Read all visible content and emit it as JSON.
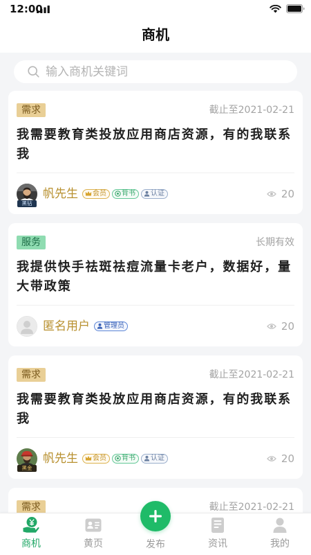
{
  "status_bar": {
    "time": "12:00",
    "icons": [
      "signal-icon",
      "wifi-icon",
      "battery-icon"
    ]
  },
  "header": {
    "title": "商机"
  },
  "search": {
    "placeholder": "输入商机关键词",
    "icon": "search-icon"
  },
  "cards": [
    {
      "tag": "需求",
      "validity": "截止至2021-02-21",
      "title": "我需要教育类投放应用商店资源，有的我联系我",
      "user": {
        "name": "帆先生",
        "level": "黑钻",
        "badges": [
          {
            "label": "会员",
            "icon": "crown-icon"
          },
          {
            "label": "背书",
            "icon": "endorse-icon"
          },
          {
            "label": "认证",
            "icon": "user-icon"
          }
        ]
      },
      "views": 20
    },
    {
      "tag": "服务",
      "validity": "长期有效",
      "title": "我提供快手祛斑祛痘流量卡老户，数据好，量大带政策",
      "user": {
        "name": "匿名用户",
        "badges": [
          {
            "label": "管理员",
            "icon": "user-icon"
          }
        ]
      },
      "views": 20
    },
    {
      "tag": "需求",
      "validity": "截止至2021-02-21",
      "title": "我需要教育类投放应用商店资源，有的我联系我",
      "user": {
        "name": "帆先生",
        "level": "黑金",
        "badges": [
          {
            "label": "会员",
            "icon": "crown-icon"
          },
          {
            "label": "背书",
            "icon": "endorse-icon"
          },
          {
            "label": "认证",
            "icon": "user-icon"
          }
        ]
      },
      "views": 20
    },
    {
      "tag": "需求",
      "validity": "截止至2021-02-21"
    }
  ],
  "nav": {
    "items": [
      {
        "label": "商机",
        "icon": "business-icon",
        "active": true
      },
      {
        "label": "黄页",
        "icon": "contacts-card-icon",
        "active": false
      },
      {
        "label": "发布",
        "icon": "plus-icon",
        "active": false
      },
      {
        "label": "资讯",
        "icon": "news-icon",
        "active": false
      },
      {
        "label": "我的",
        "icon": "profile-icon",
        "active": false
      }
    ]
  },
  "colors": {
    "accent": "#22a867",
    "publish_button": "#1fbb68",
    "username": "#b8902f",
    "demand_tag_bg": "#e9cf96",
    "service_tag_bg": "#8fdcb1",
    "page_bg": "#f4f5f7",
    "inactive_nav": "#9b9b9b"
  }
}
